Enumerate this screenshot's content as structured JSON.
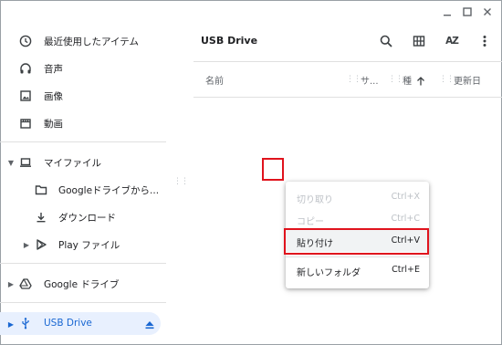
{
  "window": {
    "minimize_icon": "minimize-icon",
    "maximize_icon": "maximize-icon",
    "close_icon": "close-icon"
  },
  "sidebar": {
    "recent": {
      "label": "最近使用したアイテム",
      "icon": "clock-icon"
    },
    "audio": {
      "label": "音声",
      "icon": "headphones-icon"
    },
    "images": {
      "label": "画像",
      "icon": "image-icon"
    },
    "videos": {
      "label": "動画",
      "icon": "film-icon"
    },
    "my_files": {
      "label": "マイファイル",
      "icon": "laptop-icon"
    },
    "google_drive_folder": {
      "label": "Googleドライブから...",
      "icon": "folder-icon"
    },
    "downloads": {
      "label": "ダウンロード",
      "icon": "download-icon"
    },
    "play_files": {
      "label": "Play ファイル",
      "icon": "play-icon"
    },
    "google_drive": {
      "label": "Google ドライブ",
      "icon": "drive-icon"
    },
    "usb_drive": {
      "label": "USB Drive",
      "icon": "usb-icon",
      "eject_icon": "eject-icon"
    }
  },
  "main": {
    "title": "USB Drive",
    "toolbar": {
      "search_icon": "search-icon",
      "grid_icon": "grid-view-icon",
      "sort_label": "AZ",
      "more_icon": "more-vert-icon"
    },
    "columns": {
      "name": "名前",
      "size": "サ...",
      "type": "種",
      "modified": "更新日"
    }
  },
  "context_menu": {
    "cut": {
      "label": "切り取り",
      "shortcut": "Ctrl+X",
      "enabled": false
    },
    "copy": {
      "label": "コピー",
      "shortcut": "Ctrl+C",
      "enabled": false
    },
    "paste": {
      "label": "貼り付け",
      "shortcut": "Ctrl+V",
      "enabled": true
    },
    "new_folder": {
      "label": "新しいフォルダ",
      "shortcut": "Ctrl+E",
      "enabled": true
    }
  },
  "colors": {
    "highlight_border": "#e0131d",
    "selected_bg": "#e8f0fe",
    "selected_text": "#1967d2"
  }
}
